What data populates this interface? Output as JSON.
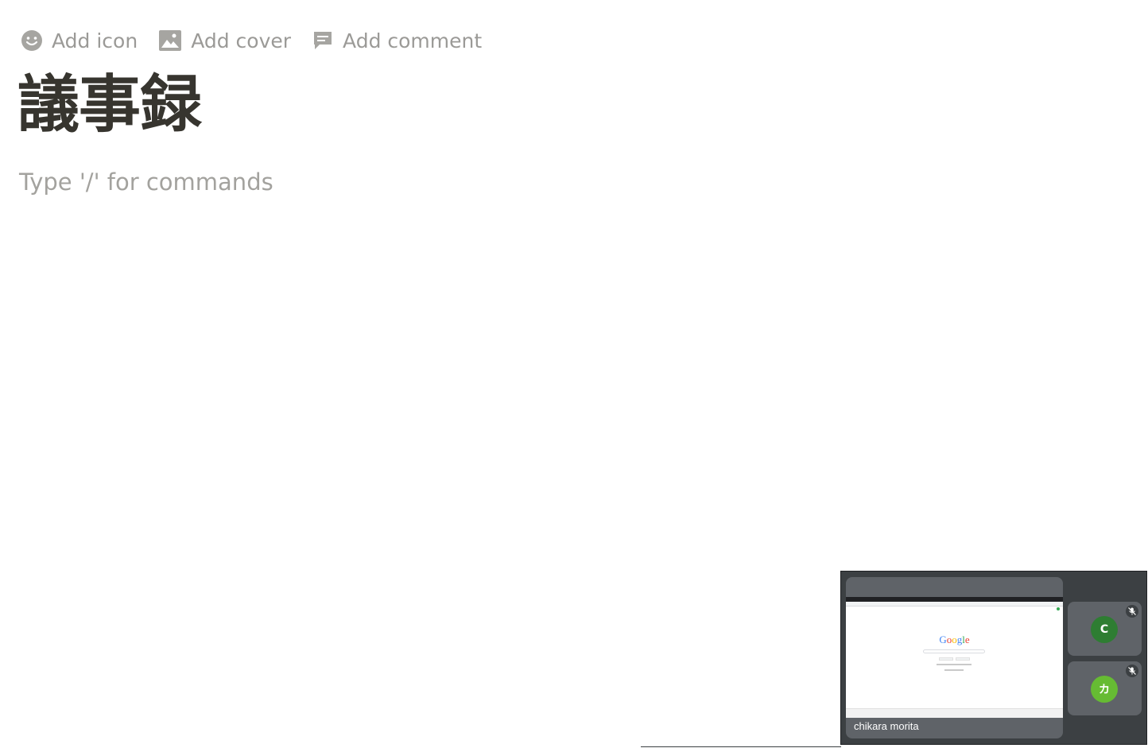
{
  "page_actions": {
    "add_icon": "Add icon",
    "add_cover": "Add cover",
    "add_comment": "Add comment"
  },
  "page": {
    "title": "議事録",
    "placeholder": "Type '/' for commands"
  },
  "meet_pip": {
    "shared_screen": {
      "logo_letters": [
        "G",
        "o",
        "o",
        "g",
        "l",
        "e"
      ],
      "logo_colors": [
        "#4285f4",
        "#ea4335",
        "#fbbc05",
        "#4285f4",
        "#34a853",
        "#ea4335"
      ]
    },
    "presenter_name": "chikara morita",
    "participants": [
      {
        "initial": "C",
        "avatar_color": "#2e7d32",
        "muted": true
      },
      {
        "initial": "カ",
        "avatar_color": "#66bb33",
        "muted": true
      }
    ]
  },
  "colors": {
    "text_primary": "#37352f",
    "text_muted": "#9b9a97",
    "pip_background": "#3c4043",
    "tile_background": "#5f6368"
  }
}
